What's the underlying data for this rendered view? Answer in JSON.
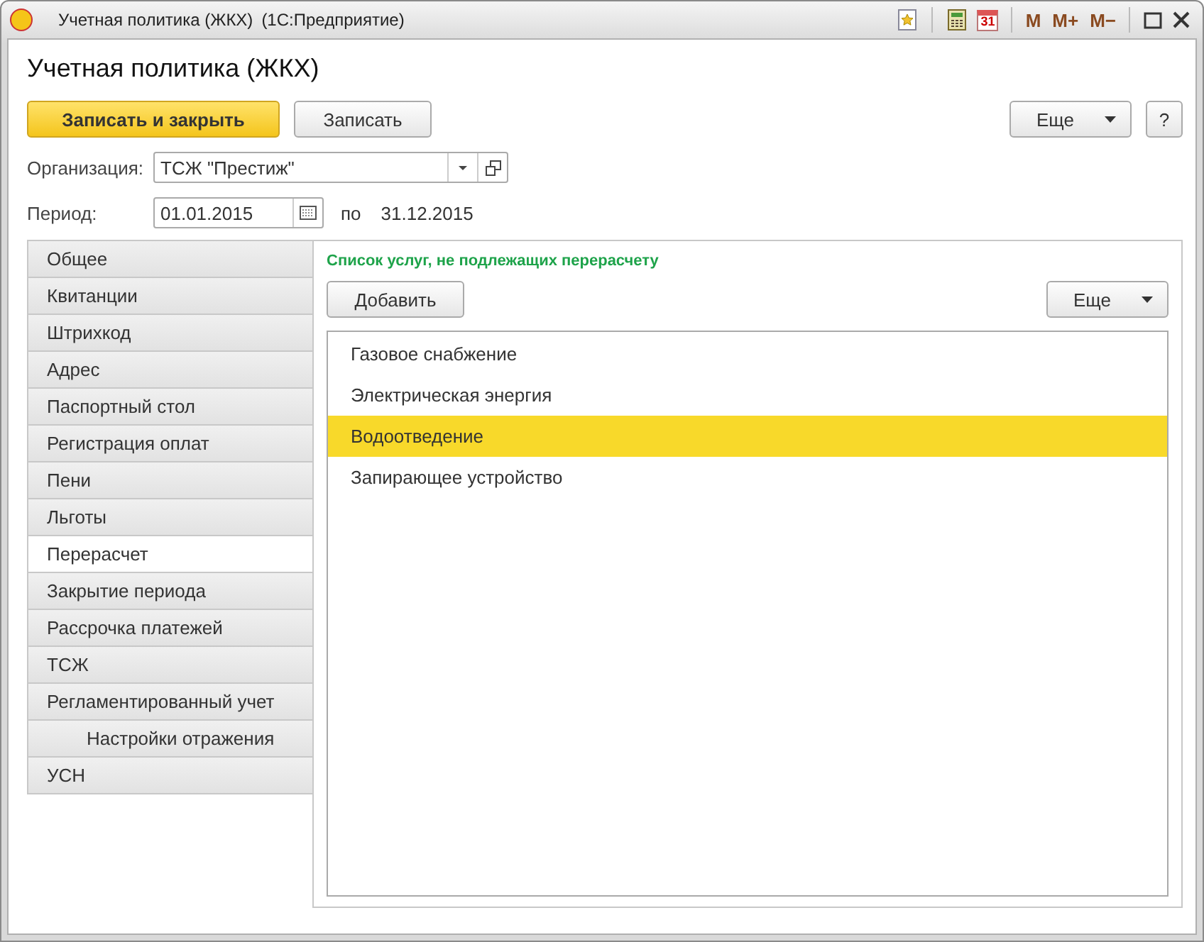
{
  "window": {
    "title": "Учетная политика (ЖКХ)",
    "subtitle": "(1С:Предприятие)",
    "calendar_day": "31",
    "memory_buttons": [
      "M",
      "M+",
      "M−"
    ]
  },
  "form": {
    "title": "Учетная политика (ЖКХ)"
  },
  "toolbar": {
    "primary": "Записать и закрыть",
    "secondary": "Записать",
    "more": "Еще",
    "help": "?"
  },
  "organization": {
    "label": "Организация:",
    "value": "ТСЖ \"Престиж\""
  },
  "period": {
    "label": "Период:",
    "from": "01.01.2015",
    "to_label": "по",
    "to": "31.12.2015"
  },
  "tabs": [
    {
      "label": "Общее",
      "selected": false
    },
    {
      "label": "Квитанции",
      "selected": false
    },
    {
      "label": "Штрихкод",
      "selected": false
    },
    {
      "label": "Адрес",
      "selected": false
    },
    {
      "label": "Паспортный стол",
      "selected": false
    },
    {
      "label": "Регистрация оплат",
      "selected": false
    },
    {
      "label": "Пени",
      "selected": false
    },
    {
      "label": "Льготы",
      "selected": false
    },
    {
      "label": "Перерасчет",
      "selected": true
    },
    {
      "label": "Закрытие периода",
      "selected": false
    },
    {
      "label": "Рассрочка платежей",
      "selected": false
    },
    {
      "label": "ТСЖ",
      "selected": false
    },
    {
      "label": "Регламентированный учет",
      "selected": false,
      "children": [
        {
          "label": "Настройки отражения",
          "selected": false
        }
      ]
    },
    {
      "label": "УСН",
      "selected": false
    }
  ],
  "panel": {
    "heading": "Список услуг, не подлежащих перерасчету",
    "add_button": "Добавить",
    "more_button": "Еще",
    "items": [
      {
        "label": "Газовое снабжение",
        "selected": false
      },
      {
        "label": "Электрическая энергия",
        "selected": false
      },
      {
        "label": "Водоотведение",
        "selected": true
      },
      {
        "label": "Запирающее устройство",
        "selected": false
      }
    ]
  }
}
